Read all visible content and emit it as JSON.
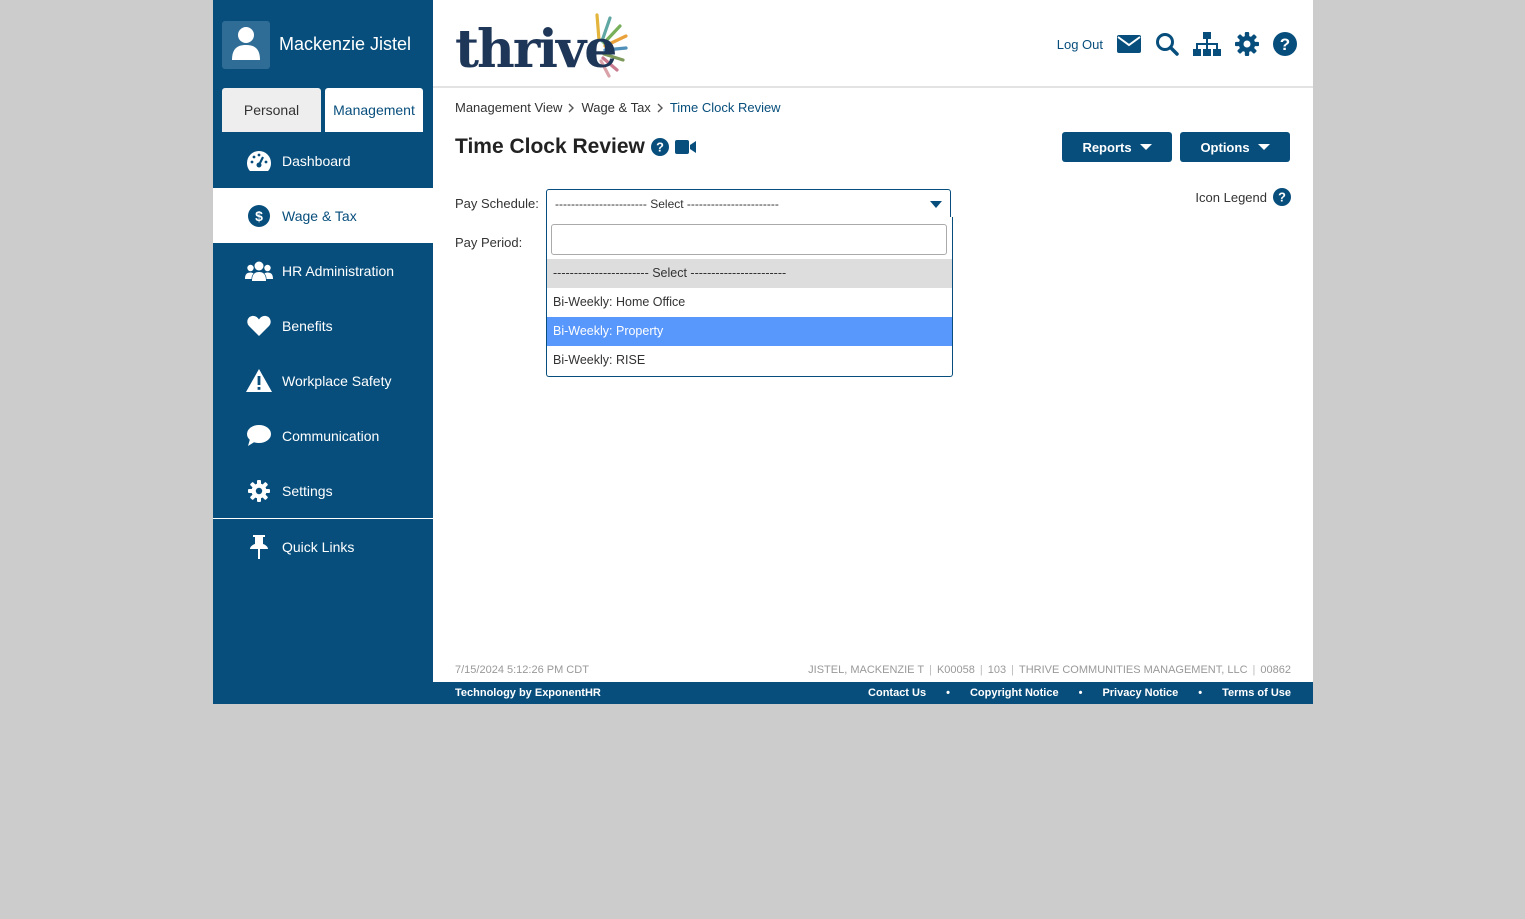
{
  "user": {
    "name": "Mackenzie Jistel"
  },
  "view_tabs": [
    {
      "label": "Personal"
    },
    {
      "label": "Management"
    }
  ],
  "nav": [
    {
      "label": "Dashboard",
      "icon": "dashboard-icon"
    },
    {
      "label": "Wage & Tax",
      "icon": "dollar-icon"
    },
    {
      "label": "HR Administration",
      "icon": "users-icon"
    },
    {
      "label": "Benefits",
      "icon": "heart-icon"
    },
    {
      "label": "Workplace Safety",
      "icon": "warning-icon"
    },
    {
      "label": "Communication",
      "icon": "chat-icon"
    },
    {
      "label": "Settings",
      "icon": "gear-icon"
    }
  ],
  "quick_links": {
    "label": "Quick Links"
  },
  "logo": {
    "text": "thrive"
  },
  "header": {
    "logout": "Log Out"
  },
  "breadcrumb": [
    "Management View",
    "Wage & Tax",
    "Time Clock Review"
  ],
  "page": {
    "title": "Time Clock Review",
    "reports_label": "Reports",
    "options_label": "Options",
    "icon_legend": "Icon Legend"
  },
  "form": {
    "pay_schedule_label": "Pay Schedule:",
    "pay_period_label": "Pay Period:",
    "selected": "----------------------- Select -----------------------",
    "search_value": "",
    "options": [
      "----------------------- Select -----------------------",
      "Bi-Weekly: Home Office",
      "Bi-Weekly: Property",
      "Bi-Weekly: RISE"
    ]
  },
  "status": {
    "timestamp": "7/15/2024 5:12:26 PM CDT",
    "name": "JISTEL, MACKENZIE T",
    "id": "K00058",
    "code": "103",
    "company": "THRIVE COMMUNITIES MANAGEMENT, LLC",
    "company_code": "00862"
  },
  "footer": {
    "tech": "Technology by ExponentHR",
    "links": [
      "Contact Us",
      "Copyright Notice",
      "Privacy Notice",
      "Terms of Use"
    ]
  },
  "colors": {
    "brand": "#074e7c",
    "highlight": "#5897fb",
    "background": "#cccccc"
  }
}
